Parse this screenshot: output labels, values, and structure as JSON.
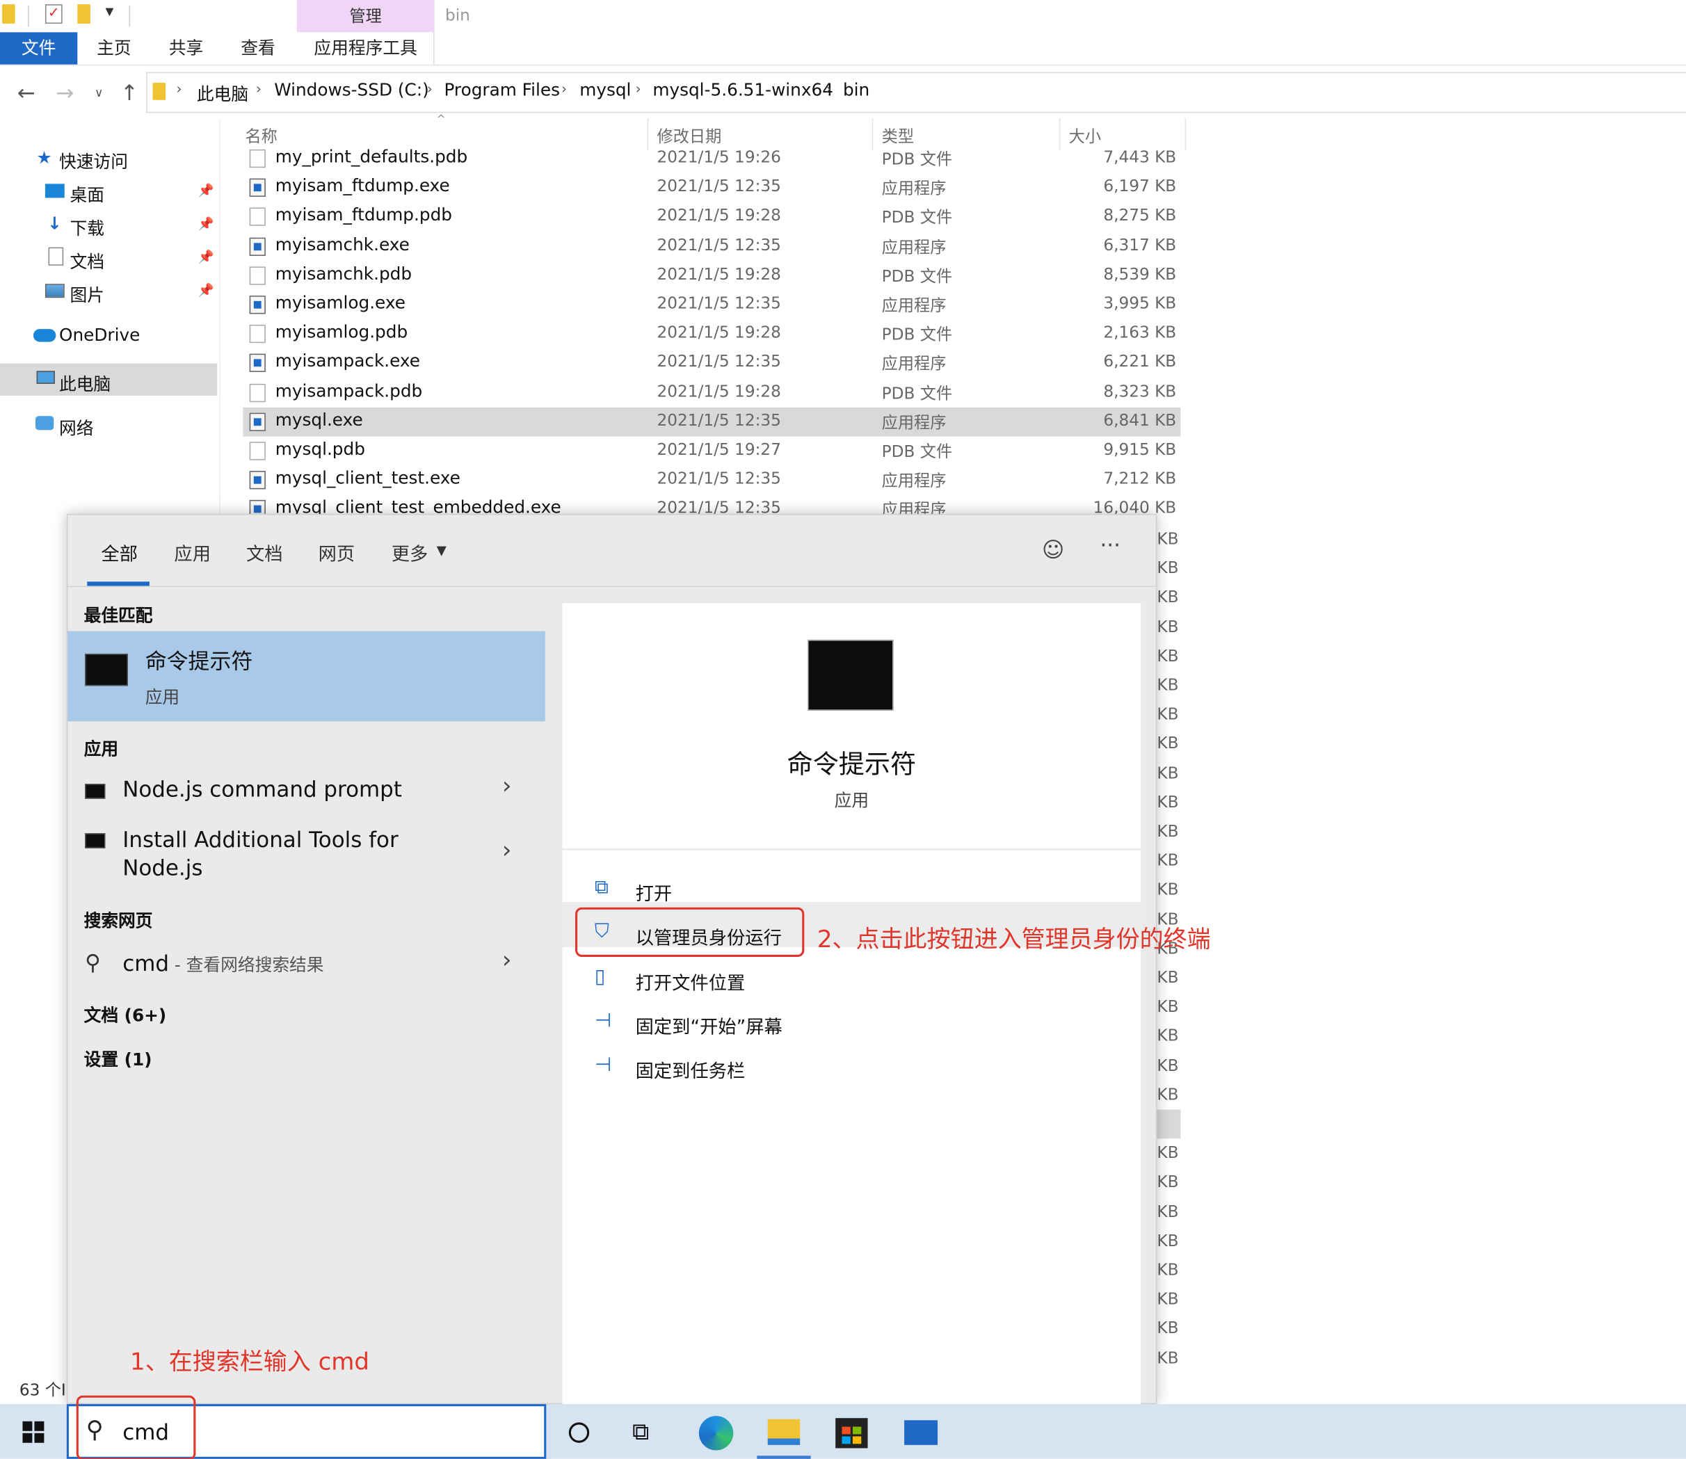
{
  "ribbon": {
    "file_tab": "文件",
    "tabs": [
      "主页",
      "共享",
      "查看"
    ],
    "context_group": "管理",
    "context_tab": "应用程序工具",
    "window_title": "bin"
  },
  "address": {
    "crumbs": [
      "此电脑",
      "Windows-SSD (C:)",
      "Program Files",
      "mysql",
      "mysql-5.6.51-winx64",
      "bin"
    ]
  },
  "sidebar": {
    "quick_access": "快速访问",
    "items": [
      "桌面",
      "下载",
      "文档",
      "图片"
    ],
    "onedrive": "OneDrive",
    "this_pc": "此电脑",
    "network": "网络"
  },
  "list": {
    "headers": {
      "name": "名称",
      "date": "修改日期",
      "type": "类型",
      "size": "大小"
    },
    "files": [
      {
        "name": "my_print_defaults.pdb",
        "date": "2021/1/5 19:26",
        "type": "PDB 文件",
        "size": "7,443 KB"
      },
      {
        "name": "myisam_ftdump.exe",
        "date": "2021/1/5 12:35",
        "type": "应用程序",
        "size": "6,197 KB"
      },
      {
        "name": "myisam_ftdump.pdb",
        "date": "2021/1/5 19:28",
        "type": "PDB 文件",
        "size": "8,275 KB"
      },
      {
        "name": "myisamchk.exe",
        "date": "2021/1/5 12:35",
        "type": "应用程序",
        "size": "6,317 KB"
      },
      {
        "name": "myisamchk.pdb",
        "date": "2021/1/5 19:28",
        "type": "PDB 文件",
        "size": "8,539 KB"
      },
      {
        "name": "myisamlog.exe",
        "date": "2021/1/5 12:35",
        "type": "应用程序",
        "size": "3,995 KB"
      },
      {
        "name": "myisamlog.pdb",
        "date": "2021/1/5 19:28",
        "type": "PDB 文件",
        "size": "2,163 KB"
      },
      {
        "name": "myisampack.exe",
        "date": "2021/1/5 12:35",
        "type": "应用程序",
        "size": "6,221 KB"
      },
      {
        "name": "myisampack.pdb",
        "date": "2021/1/5 19:28",
        "type": "PDB 文件",
        "size": "8,323 KB"
      },
      {
        "name": "mysql.exe",
        "date": "2021/1/5 12:35",
        "type": "应用程序",
        "size": "6,841 KB"
      },
      {
        "name": "mysql.pdb",
        "date": "2021/1/5 19:27",
        "type": "PDB 文件",
        "size": "9,915 KB"
      },
      {
        "name": "mysql_client_test.exe",
        "date": "2021/1/5 12:35",
        "type": "应用程序",
        "size": "7,212 KB"
      },
      {
        "name": "mysql_client_test_embedded.exe",
        "date": "2021/1/5 12:35",
        "type": "应用程序",
        "size": "16,040 KB"
      }
    ],
    "size_unit_tail": "KB",
    "status": "63 个I"
  },
  "search": {
    "tabs": [
      "全部",
      "应用",
      "文档",
      "网页",
      "更多"
    ],
    "best_match_heading": "最佳匹配",
    "best_match_name": "命令提示符",
    "best_match_kind": "应用",
    "apps_heading": "应用",
    "apps": [
      "Node.js command prompt",
      "Install Additional Tools for Node.js"
    ],
    "web_heading": "搜索网页",
    "web_query": "cmd",
    "web_suffix": " - 查看网络搜索结果",
    "docs": "文档 (6+)",
    "settings": "设置 (1)",
    "detail_name": "命令提示符",
    "detail_kind": "应用",
    "actions": [
      "打开",
      "以管理员身份运行",
      "打开文件位置",
      "固定到“开始”屏幕",
      "固定到任务栏"
    ],
    "query": "cmd"
  },
  "annotations": {
    "step1": "1、在搜索栏输入 cmd",
    "step2": "2、点击此按钮进入管理员身份的终端",
    "color": "#e0362b"
  }
}
